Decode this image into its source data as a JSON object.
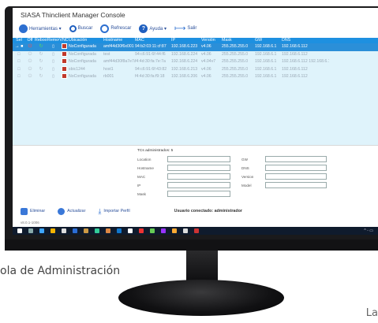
{
  "app": {
    "title": "SIASA Thinclient Manager Console"
  },
  "toolbar": {
    "tools_label": "Herramientas ▾",
    "search_label": "Buscar",
    "refresh_label": "Refrescar",
    "help_label": "Ayuda ▾",
    "exit_label": "Salir"
  },
  "table": {
    "columns": [
      "Sel",
      "Off",
      "Reboot",
      "Remove",
      "VNC",
      "Ubicación",
      "Hostname",
      "MAC",
      "IP",
      "Versión",
      "Mask",
      "GW",
      "DNS"
    ],
    "rows": [
      {
        "ubicacion": "NoConfigurada",
        "hostname": "amf44d30f6x001",
        "mac": "94:b2:03:11:cf:87",
        "ip": "192.168.6.223",
        "version": "v4.06",
        "mask": "255.255.255.0",
        "gw": "192.168.6.1",
        "dns": "192.168.6.112",
        "selected": true
      },
      {
        "ubicacion": "NoConfigurada",
        "hostname": "test",
        "mac": "94:c6:91:6f:44:f6",
        "ip": "192.168.6.224",
        "version": "v4.06",
        "mask": "255.255.255.0",
        "gw": "192.168.6.1",
        "dns": "192.168.6.112",
        "selected": false
      },
      {
        "ubicacion": "NoConfigurada",
        "hostname": "amf44d30f8a7e7a",
        "mac": "f4:4d:30:fa:7e:7a",
        "ip": "192.168.6.224",
        "version": "v4.04v7",
        "mask": "255.255.255.0",
        "gw": "192.168.6.1",
        "dns": "192.168.6.112 192.168.6.1",
        "selected": false
      },
      {
        "ubicacion": "sbic1244",
        "hostname": "host1",
        "mac": "94:c6:91:6f:43:82",
        "ip": "192.168.6.213",
        "version": "v4.06",
        "mask": "255.255.255.0",
        "gw": "192.168.6.1",
        "dns": "192.168.6.112",
        "selected": false
      },
      {
        "ubicacion": "NoConfigurada",
        "hostname": "rb001",
        "mac": "f4:4d:30:fa:f9:18",
        "ip": "192.168.6.206",
        "version": "v4.06",
        "mask": "255.255.255.0",
        "gw": "192.168.6.1",
        "dns": "192.168.6.112",
        "selected": false
      }
    ]
  },
  "detail": {
    "count_label": "TCs administrados: 5",
    "location_label": "Location",
    "hostname_label": "Hostname",
    "mac_label": "MAC",
    "ip_label": "IP",
    "mask_label": "Mask",
    "gw_label": "GW",
    "dns_label": "DNS",
    "version_label": "Version",
    "model_label": "Model"
  },
  "bottom": {
    "delete_label": "Eliminar",
    "update_label": "Actualizar",
    "import_label": "Importar Perfil",
    "user_label": "Usuario conectado: administrador",
    "version_label": "v8.0.1-1006"
  },
  "caption": {
    "text": "ola de Administración",
    "corner": "La"
  },
  "colors": {
    "header_blue": "#1e90e0",
    "selected_row": "#2b8fd8",
    "grid_bg": "#dff3fb",
    "taskbar": "#0f1b2d"
  }
}
